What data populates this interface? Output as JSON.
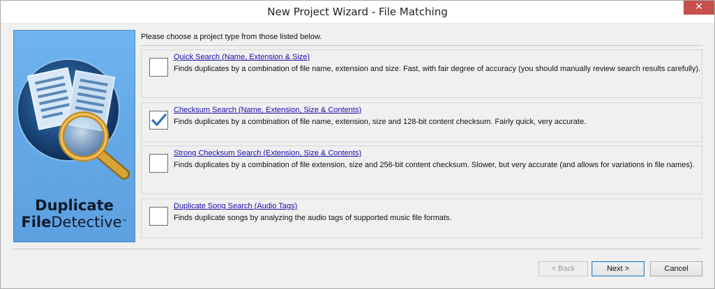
{
  "window": {
    "title": "New Project Wizard - File Matching",
    "close_glyph": "✕"
  },
  "side_panel": {
    "brand_line1": "Duplicate",
    "brand_line2_bold": "File",
    "brand_line2_rest": "Detective",
    "trademark": "™"
  },
  "prompt": "Please choose a project type from those listed below.",
  "options": [
    {
      "title": "Quick Search (Name, Extension & Size)",
      "description": "Finds duplicates by a combination of file name, extension and size. Fast, with fair degree of accuracy (you should manually review search results carefully).",
      "checked": false
    },
    {
      "title": "Checksum Search (Name, Extension, Size & Contents)",
      "description": "Finds duplicates by a combination of file name, extension, size and 128-bit content checksum. Fairly quick, very accurate.",
      "checked": true
    },
    {
      "title": "Strong Checksum Search (Extension, Size & Contents)",
      "description": "Finds duplicates by a combination of file extension, size and 256-bit content checksum. Slower, but very accurate (and allows for variations in file names).",
      "checked": false
    },
    {
      "title": "Duplicate Song Search (Audio Tags)",
      "description": "Finds duplicate songs by analyzing the audio tags of supported music file formats.",
      "checked": false
    }
  ],
  "buttons": {
    "back": "< Back",
    "next": "Next >",
    "cancel": "Cancel"
  },
  "colors": {
    "accent": "#3b76b9",
    "link": "#1a0dab",
    "panel": "#63a9e8",
    "close": "#c7504a"
  }
}
